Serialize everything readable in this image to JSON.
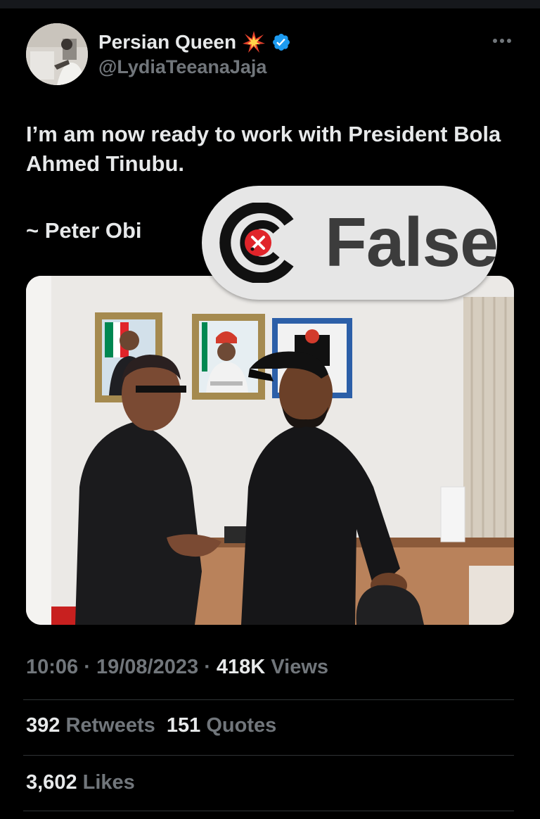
{
  "author": {
    "display_name": "Persian Queen",
    "emoji_icon": "collision-spark-icon",
    "verified_icon": "verified-badge-icon",
    "verified_color": "#1d9bf0",
    "handle": "@LydiaTeeanaJaja"
  },
  "tweet": {
    "text": "I’m am now ready to work with President Bola Ahmed Tinubu.",
    "attribution": "~ Peter Obi"
  },
  "overlay": {
    "label": "False",
    "logo_icon": "false-check-logo-icon",
    "accent_color": "#e0242a"
  },
  "meta": {
    "time": "10:06",
    "separator": "·",
    "date": "19/08/2023",
    "views_count": "418K",
    "views_label": "Views"
  },
  "stats": {
    "retweets_count": "392",
    "retweets_label": "Retweets",
    "quotes_count": "151",
    "quotes_label": "Quotes",
    "likes_count": "3,602",
    "likes_label": "Likes"
  },
  "colors": {
    "background": "#000000",
    "text": "#e7e9ea",
    "muted": "#71767b",
    "divider": "#2f3336"
  }
}
